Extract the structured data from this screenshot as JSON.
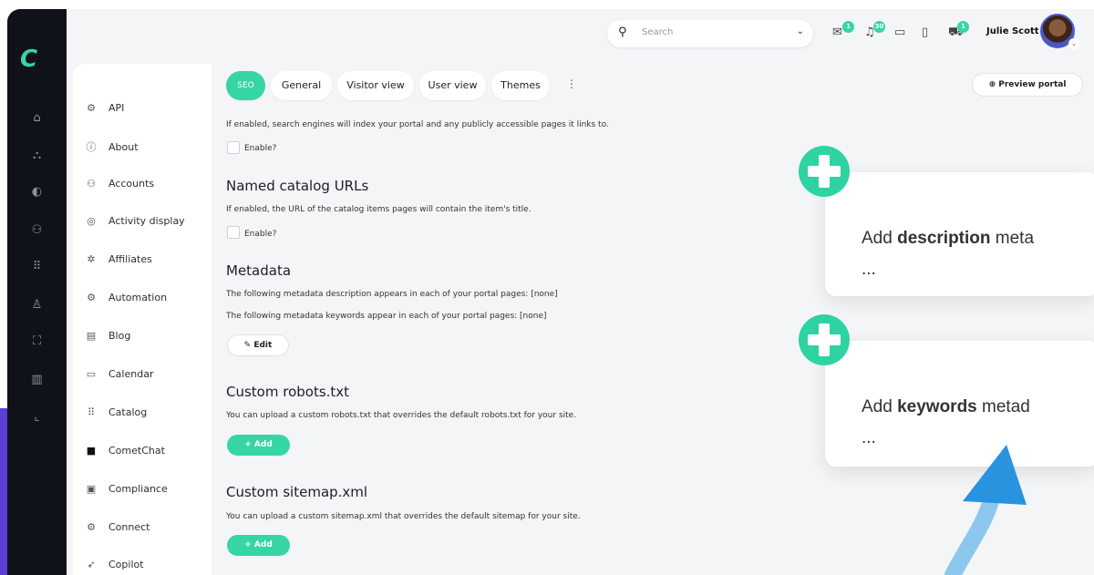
{
  "app": {
    "logo_text": "C"
  },
  "rail": {
    "icons": [
      "home-icon",
      "org-chart-icon",
      "palette-icon",
      "users-icon",
      "grid-icon",
      "person-icon",
      "network-icon",
      "library-icon",
      "chart-icon"
    ]
  },
  "sidebar": {
    "items": [
      {
        "label": "API",
        "icon": "gear-icon"
      },
      {
        "label": "About",
        "icon": "info-icon"
      },
      {
        "label": "Accounts",
        "icon": "people-icon"
      },
      {
        "label": "Activity display",
        "icon": "target-icon"
      },
      {
        "label": "Affiliates",
        "icon": "handshake-icon"
      },
      {
        "label": "Automation",
        "icon": "gear-icon"
      },
      {
        "label": "Blog",
        "icon": "document-icon"
      },
      {
        "label": "Calendar",
        "icon": "calendar-icon"
      },
      {
        "label": "Catalog",
        "icon": "grid-icon"
      },
      {
        "label": "CometChat",
        "icon": "chat-icon"
      },
      {
        "label": "Compliance",
        "icon": "clipboard-icon"
      },
      {
        "label": "Connect",
        "icon": "gear-icon"
      },
      {
        "label": "Copilot",
        "icon": "rocket-icon"
      }
    ]
  },
  "topbar": {
    "search_placeholder": "Search",
    "badges": {
      "messages": "1",
      "notifications": "30",
      "cart": "1"
    },
    "user_name": "Julie Scott"
  },
  "tabs": [
    {
      "label": "SEO",
      "active": true
    },
    {
      "label": "General",
      "active": false
    },
    {
      "label": "Visitor view",
      "active": false
    },
    {
      "label": "User view",
      "active": false
    },
    {
      "label": "Themes",
      "active": false
    }
  ],
  "preview_button": "Preview portal",
  "content": {
    "seo_desc": "If enabled, search engines will index your portal and any publicly accessible pages it links to.",
    "enable_label": "Enable?",
    "named_title": "Named catalog URLs",
    "named_desc": "If enabled, the URL of the catalog items pages will contain the item's title.",
    "metadata_title": "Metadata",
    "metadata_line1": "The following metadata description appears in each of your portal pages: [none]",
    "metadata_line2": "The following metadata keywords appear in each of your portal pages: [none]",
    "edit_label": "Edit",
    "robots_title": "Custom robots.txt",
    "robots_desc": "You can upload a custom robots.txt that overrides the default robots.txt for your site.",
    "sitemap_title": "Custom sitemap.xml",
    "sitemap_desc": "You can upload a custom sitemap.xml that overrides the default sitemap for your site.",
    "add_label": "+ Add"
  },
  "callouts": [
    {
      "prefix": "Add ",
      "bold": "description",
      "suffix": " meta",
      "line2": "..."
    },
    {
      "prefix": "Add ",
      "bold": "keywords",
      "suffix": " metad",
      "line2": "..."
    }
  ],
  "colors": {
    "accent": "#35d6a4",
    "rail": "#0f1219",
    "arrow": "#2a93e0",
    "edge": "#5b3fd6"
  }
}
